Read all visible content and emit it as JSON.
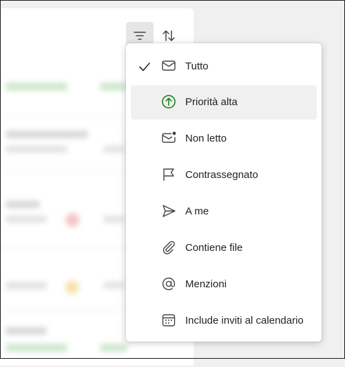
{
  "toolbar": {
    "filter_icon": "filter-icon",
    "sort_icon": "sort-arrows-icon"
  },
  "filter_menu": {
    "items": [
      {
        "label": "Tutto",
        "icon": "mail-icon",
        "selected": true
      },
      {
        "label": "Priorità alta",
        "icon": "arrow-up-circle-icon",
        "selected": false
      },
      {
        "label": "Non letto",
        "icon": "mail-unread-icon",
        "selected": false
      },
      {
        "label": "Contrassegnato",
        "icon": "flag-icon",
        "selected": false
      },
      {
        "label": "A me",
        "icon": "send-icon",
        "selected": false
      },
      {
        "label": "Contiene file",
        "icon": "attach-icon",
        "selected": false
      },
      {
        "label": "Menzioni",
        "icon": "mention-icon",
        "selected": false
      },
      {
        "label": "Include inviti al calendario",
        "icon": "calendar-icon",
        "selected": false
      }
    ]
  },
  "colors": {
    "accent_green": "#0e7a0d",
    "menu_bg": "#ffffff",
    "hover_bg": "#f0f0f0"
  }
}
